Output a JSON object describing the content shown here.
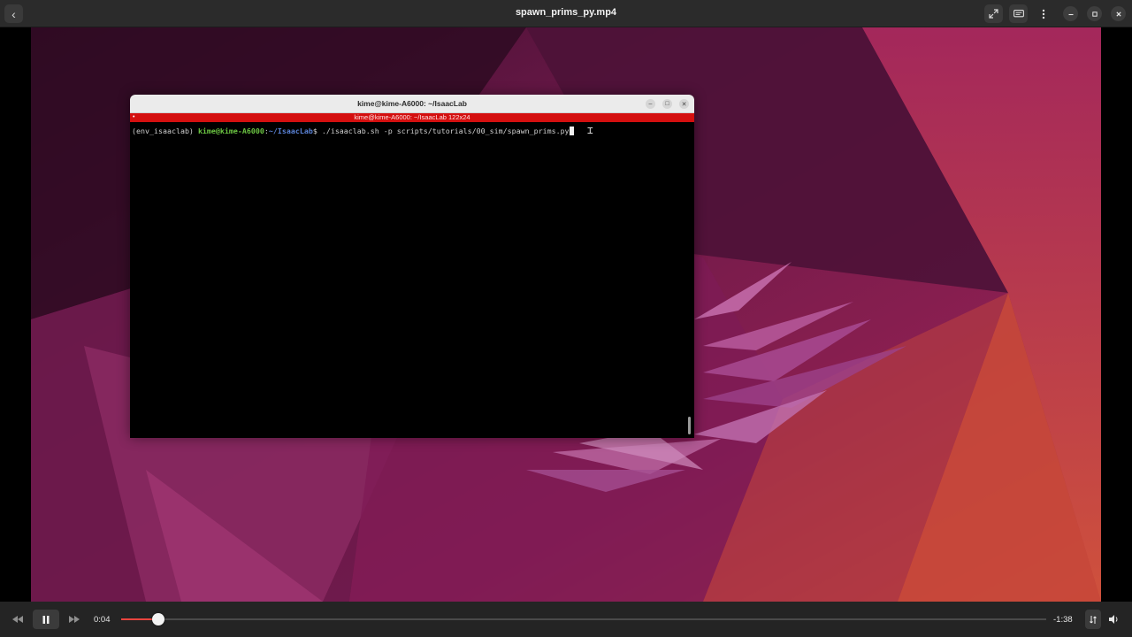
{
  "player": {
    "title": "spawn_prims_py.mp4",
    "back_icon": "chevron-left-icon",
    "fullscreen_icon": "fullscreen-icon",
    "subtitles_icon": "subtitles-icon",
    "menu_icon": "kebab-menu-icon",
    "minimize_icon": "minimize-icon",
    "maximize_icon": "maximize-icon",
    "close_icon": "close-icon"
  },
  "terminal": {
    "title": "kime@kime-A6000: ~/IsaacLab",
    "resize_banner": "kime@kime-A6000: ~/IsaacLab 122x24",
    "prompt_env": "(env_isaaclab) ",
    "prompt_user": "kime@kime-A6000",
    "prompt_sep": ":",
    "prompt_path": "~/IsaacLab",
    "prompt_symbol": "$ ",
    "command": "./isaaclab.sh -p scripts/tutorials/00_sim/spawn_prims.py"
  },
  "controls": {
    "elapsed": "0:04",
    "remaining": "-1:38",
    "progress": 0.04,
    "prev_icon": "skip-backward-icon",
    "pause_icon": "pause-icon",
    "next_icon": "skip-forward-icon",
    "audio_track_icon": "audio-track-icon",
    "volume_icon": "volume-icon"
  },
  "colors": {
    "accent": "#e9453e",
    "prompt_user": "#6cc542",
    "prompt_path": "#5a82d6",
    "resize_banner": "#d40f0f"
  }
}
